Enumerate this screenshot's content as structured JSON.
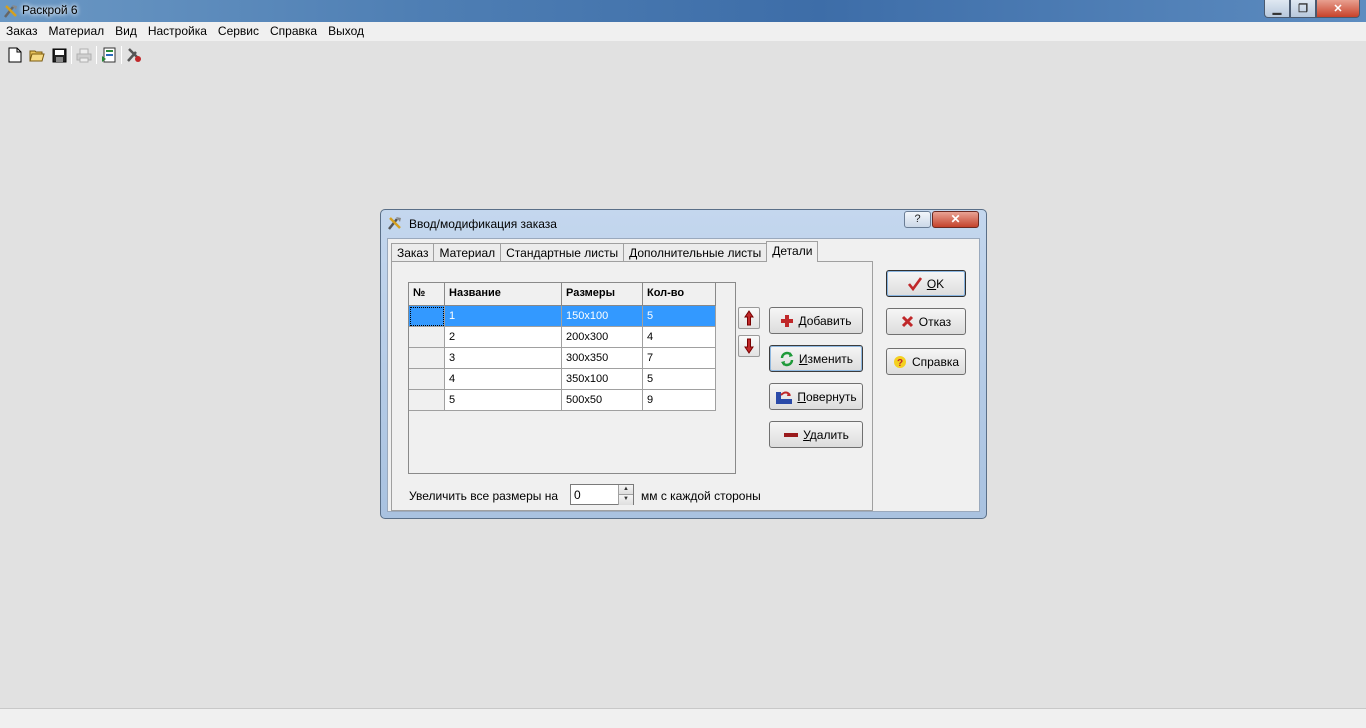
{
  "window": {
    "title": "Раскрой 6",
    "min_glyph": "▁",
    "max_glyph": "❐",
    "close_glyph": "✕"
  },
  "menu": [
    "Заказ",
    "Материал",
    "Вид",
    "Настройка",
    "Сервис",
    "Справка",
    "Выход"
  ],
  "toolbar": {
    "icons": [
      "new-file-icon",
      "open-folder-icon",
      "save-icon",
      "print-icon",
      "import-icon",
      "tools-icon"
    ]
  },
  "dialog": {
    "title": "Ввод/модификация заказа",
    "help_glyph": "?",
    "close_glyph": "✕",
    "tabs": [
      "Заказ",
      "Материал",
      "Стандартные листы",
      "Дополнительные листы",
      "Детали"
    ],
    "active_tab": 4,
    "table": {
      "headers": [
        "№",
        "Название",
        "Размеры",
        "Кол-во"
      ],
      "rows": [
        [
          "",
          "1",
          "150x100",
          "5"
        ],
        [
          "",
          "2",
          "200x300",
          "4"
        ],
        [
          "",
          "3",
          "300x350",
          "7"
        ],
        [
          "",
          "4",
          "350x100",
          "5"
        ],
        [
          "",
          "5",
          "500x50",
          "9"
        ]
      ],
      "selected_row": 0
    },
    "buttons": {
      "add": {
        "u": "Д",
        "rest": "обавить"
      },
      "edit": {
        "u": "И",
        "rest": "зменить"
      },
      "rotate": {
        "u": "П",
        "rest": "овернуть"
      },
      "delete": {
        "u": "У",
        "rest": "далить"
      }
    },
    "enlarge_label": "Увеличить все размеры на",
    "enlarge_value": "0",
    "enlarge_suffix": "мм с каждой стороны",
    "right_buttons": {
      "ok": {
        "u": "O",
        "rest": "K"
      },
      "cancel": "Отказ",
      "help": "Справка"
    },
    "colors": {
      "selection": "#3399ff",
      "accent_red": "#c0282a",
      "accent_green": "#1f9a3a"
    }
  }
}
